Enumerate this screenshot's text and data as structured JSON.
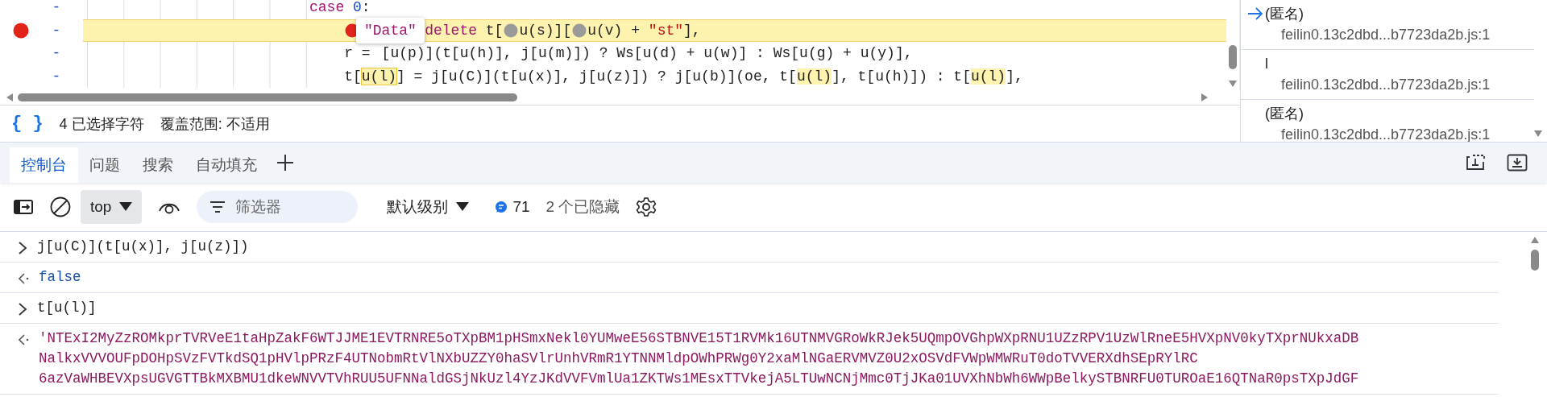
{
  "editor": {
    "lines": [
      {
        "gutter": "-",
        "breakpoint": false,
        "current": false,
        "segments": [
          {
            "kind": "keyword",
            "text": "case"
          },
          {
            "kind": "space"
          },
          {
            "kind": "number",
            "text": "0"
          },
          {
            "kind": "plain",
            "text": ":"
          }
        ],
        "children": [
          {
            "gutter": "-",
            "breakpoint": true,
            "current": true,
            "segments": [
              {
                "kind": "marker",
                "on": true
              },
              {
                "kind": "gap"
              },
              {
                "kind": "keyword",
                "text": "delete"
              },
              {
                "kind": "plain",
                "text": " t["
              },
              {
                "kind": "marker",
                "on": false
              },
              {
                "kind": "plain",
                "text": "u(s)]["
              },
              {
                "kind": "marker",
                "on": false
              },
              {
                "kind": "plain",
                "text": "u(v) + "
              },
              {
                "kind": "string",
                "text": "\"st\""
              },
              {
                "kind": "plain",
                "text": "],"
              }
            ]
          },
          {
            "gutter": "-",
            "breakpoint": false,
            "current": false,
            "segments": [
              {
                "kind": "plain",
                "text": "r ="
              },
              {
                "kind": "gap"
              },
              {
                "kind": "plain",
                "text": "[u(p)](t[u(h)], j[u(m)]) ? Ws[u(d) + u(w)] : Ws[u(g) + u(y)],"
              }
            ]
          },
          {
            "gutter": "-",
            "breakpoint": false,
            "current": false,
            "segments": [
              {
                "kind": "plain",
                "text": "t["
              },
              {
                "kind": "selected",
                "text": "u(l)"
              },
              {
                "kind": "plain",
                "text": "] = j[u(C)](t[u(x)], j[u(z)]) ? j[u(b)](oe, t["
              },
              {
                "kind": "match",
                "text": "u(l)"
              },
              {
                "kind": "plain",
                "text": "], t[u(h)]) : t["
              },
              {
                "kind": "match",
                "text": "u(l)"
              },
              {
                "kind": "plain",
                "text": "],"
              }
            ]
          }
        ]
      }
    ],
    "tooltip": {
      "text": "\"Data\""
    },
    "status": {
      "format_icon": "{ }",
      "selection": "4 已选择字符",
      "coverage": "覆盖范围: 不适用"
    }
  },
  "call_stack": {
    "frames": [
      {
        "name": "(匿名)",
        "location": "feilin0.13c2dbd...b7723da2b.js:1",
        "selected": true
      },
      {
        "name": "l",
        "location": "feilin0.13c2dbd...b7723da2b.js:1",
        "selected": false
      },
      {
        "name": "(匿名)",
        "location": "feilin0.13c2dbd...b7723da2b.js:1",
        "selected": false
      }
    ]
  },
  "drawer": {
    "tabs": [
      {
        "label": "控制台",
        "selected": true
      },
      {
        "label": "问题",
        "selected": false
      },
      {
        "label": "搜索",
        "selected": false
      },
      {
        "label": "自动填充",
        "selected": false
      }
    ]
  },
  "toolbar": {
    "context": "top",
    "filter": {
      "placeholder": "筛选器"
    },
    "level": "默认级别",
    "message_count": "71",
    "hidden": "2 个已隐藏"
  },
  "console": {
    "entries": [
      {
        "kind": "input",
        "lines": [
          "j[u(C)](t[u(x)], j[u(z)])"
        ]
      },
      {
        "kind": "boolean",
        "lines": [
          "false"
        ]
      },
      {
        "kind": "input",
        "lines": [
          "t[u(l)]"
        ]
      },
      {
        "kind": "string",
        "lines": [
          "'NTExI2MyZzROMkprTVRVeE1taHpZakF6WTJJME1EVTRNRE5oTXpBM1pHSmxNekl0YUMweE56STBNVE15T1RVMk16UTNMVGRoWkRJek5UQmpOVGhpWXpRNU1UZzRPV1UzWlRneE5HVXpNV0kyTXprNUkxaDB",
          "NalkxVVVOUFpDOHpSVzFVTkdSQ1pHVlpPRzF4UTNobmRtVlNXbUZZY0haSVlrUnhVRmR1YTNNMldpOWhPRWg0Y2xaMlNGaERVMVZ0U2xOSVdFVWpWMWRuT0doTVVERXdhSEpRYlRC",
          "6azVaWHBEVXpsUGVGTTBkMXBMU1dkeWNVVTVhRUU5UFNNaldGSjNkUzl4YzJKdVVFVmlUa1ZKTWs1MEsxTTVkejA5LTUwNCNjMmc0TjJKa01UVXhNbWh6WWpBelkySTBNRFU0TUROaE16QTNaR0psTXpJdGF"
        ]
      }
    ]
  }
}
